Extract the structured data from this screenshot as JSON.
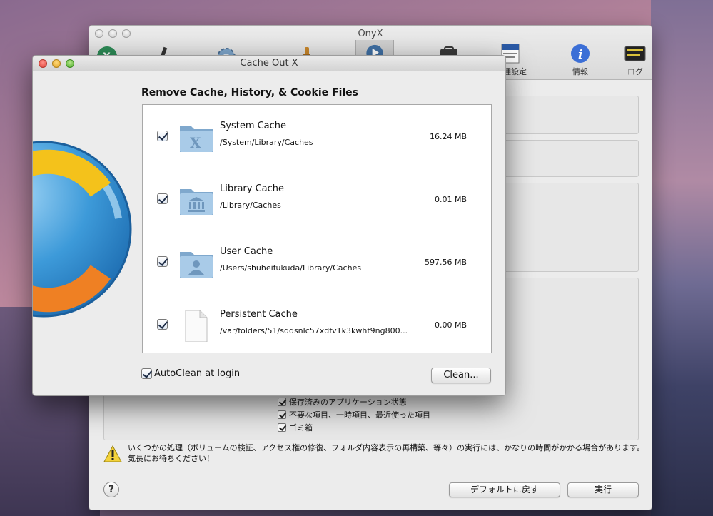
{
  "onyx": {
    "title": "OnyX",
    "toolbar": [
      {
        "label": "",
        "icon": "onyx-logo-icon"
      },
      {
        "label": "",
        "icon": "microscope-icon"
      },
      {
        "label": "",
        "icon": "gear-icon"
      },
      {
        "label": "",
        "icon": "broom-icon"
      },
      {
        "label": "",
        "icon": "play-icon"
      },
      {
        "label": "",
        "icon": "toolbox-icon"
      },
      {
        "label": "各種設定",
        "icon": "files-icon"
      },
      {
        "label": "情報",
        "icon": "info-icon"
      },
      {
        "label": "ログ",
        "icon": "console-icon"
      }
    ],
    "checks": [
      "保存済みのアプリケーション状態",
      "不要な項目、一時項目、最近使った項目",
      "ゴミ箱"
    ],
    "warning": "いくつかの処理（ボリュームの検証、アクセス権の修復、フォルダ内容表示の再構築、等々）の実行には、かなりの時間がかかる場合があります。気長にお待ちください！",
    "help_label": "?",
    "default_button": "デフォルトに戻す",
    "run_button": "実行"
  },
  "cache_out_x": {
    "title": "Cache Out X",
    "heading": "Remove Cache, History, & Cookie Files",
    "items": [
      {
        "name": "System Cache",
        "path": "/System/Library/Caches",
        "size": "16.24 MB",
        "checked": true,
        "icon": "system-folder-icon"
      },
      {
        "name": "Library Cache",
        "path": "/Library/Caches",
        "size": "0.01 MB",
        "checked": true,
        "icon": "library-folder-icon"
      },
      {
        "name": "User Cache",
        "path": "/Users/shuheifukuda/Library/Caches",
        "size": "597.56 MB",
        "checked": true,
        "icon": "user-folder-icon"
      },
      {
        "name": "Persistent Cache",
        "path": "/var/folders/51/sqdsnlc57xdfv1k3kwht9ng800...",
        "size": "0.00 MB",
        "checked": true,
        "icon": "document-icon"
      }
    ],
    "autoclean_label": "AutoClean at login",
    "autoclean_checked": true,
    "clean_button": "Clean..."
  },
  "colors": {
    "accent": "#3b8fd1",
    "folder": "#8cb6d9",
    "logo_yellow": "#f4c21b",
    "logo_orange": "#ef8023",
    "logo_blue": "#2d8fd5"
  }
}
